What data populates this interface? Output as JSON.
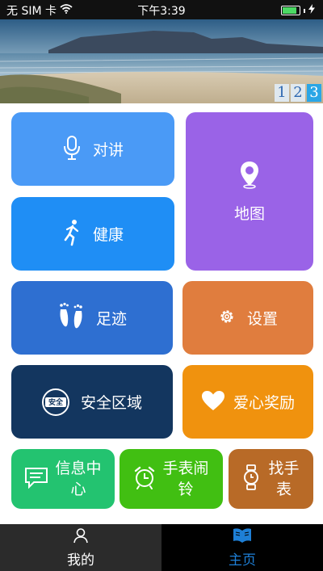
{
  "status_bar": {
    "carrier": "无 SIM 卡",
    "time": "下午3:39",
    "charge": 0.85
  },
  "banner": {
    "pages": [
      "1",
      "2",
      "3"
    ],
    "active_page": "3"
  },
  "tiles": {
    "intercom": {
      "label": "对讲",
      "icon": "microphone-icon",
      "color": "#4a9af6"
    },
    "map": {
      "label": "地图",
      "icon": "location-pin-icon",
      "color": "#9a63e7"
    },
    "health": {
      "label": "健康",
      "icon": "running-icon",
      "color": "#1f8ef5"
    },
    "footprint": {
      "label": "足迹",
      "icon": "footprints-icon",
      "color": "#2e6fd1"
    },
    "settings": {
      "label": "设置",
      "icon": "gear-icon",
      "color": "#e07d3e"
    },
    "safe_zone": {
      "label": "安全区域",
      "icon_text": "安全",
      "icon": "safe-zone-icon",
      "color": "#13365f"
    },
    "love_reward": {
      "label": "爱心奖励",
      "icon": "heart-icon",
      "color": "#f0920e"
    },
    "message_center": {
      "line1": "信息中",
      "line2": "心",
      "icon": "message-icon",
      "color": "#23c370"
    },
    "watch_alarm": {
      "line1": "手表闹",
      "line2": "铃",
      "icon": "alarm-clock-icon",
      "color": "#41bf12"
    },
    "find_watch": {
      "line1": "找手",
      "line2": "表",
      "icon": "watch-icon",
      "color": "#b86a27"
    }
  },
  "tab_bar": {
    "mine": {
      "label": "我的",
      "icon": "person-icon"
    },
    "home": {
      "label": "主页",
      "icon": "book-icon",
      "active_color": "#1e7fd6"
    }
  }
}
